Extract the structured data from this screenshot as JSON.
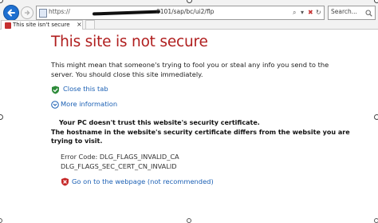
{
  "browser": {
    "address_scheme": "https://",
    "address_path": "0101/sap/bc/ui2/flp",
    "search_placeholder": "Search...",
    "tab_title": "This site isn't secure"
  },
  "page": {
    "title": "This site is not secure",
    "description": "This might mean that someone's trying to fool you or steal any info you send to the server. You should close this site immediately.",
    "close_tab_label": "Close this tab",
    "more_info_label": "More information",
    "cert_warning_line1": "Your PC doesn't trust this website's security certificate.",
    "cert_warning_line2": "The hostname in the website's security certificate differs from the website you are trying to visit.",
    "error_code": "Error Code: DLG_FLAGS_INVALID_CA",
    "error_code_2": "DLG_FLAGS_SEC_CERT_CN_INVALID",
    "go_on_label": "Go on to the webpage (not recommended)"
  },
  "colors": {
    "title_red": "#b01e1e",
    "link_blue": "#1a5fb4",
    "back_button_blue": "#1e6fd0"
  },
  "icons": {
    "back": "back-arrow-icon",
    "forward": "forward-arrow-icon",
    "close_tab": "green-shield-check-icon",
    "more_info": "chevron-circle-down-icon",
    "go_on": "red-shield-x-icon"
  }
}
